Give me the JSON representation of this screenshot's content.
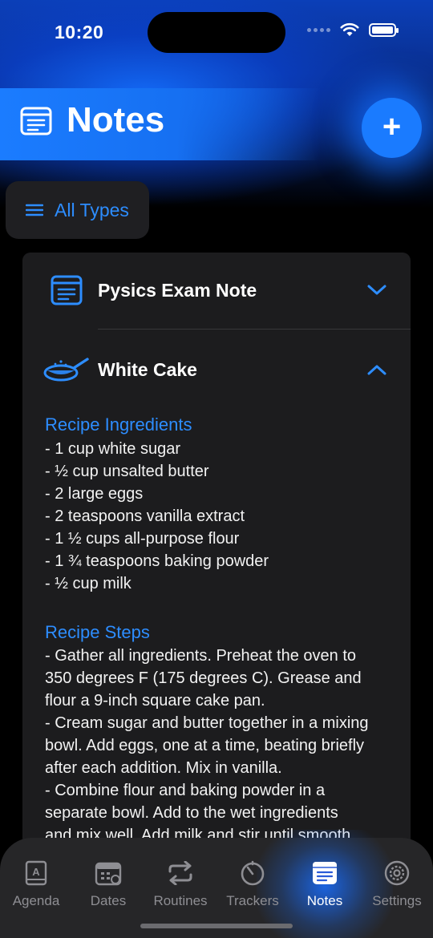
{
  "status_bar": {
    "time": "10:20"
  },
  "header": {
    "title": "Notes",
    "add_button": "+"
  },
  "filter": {
    "label": "All Types"
  },
  "notes": [
    {
      "title": "Pysics Exam Note",
      "icon": "note-icon",
      "expanded": false
    },
    {
      "title": "White Cake",
      "icon": "pan-icon",
      "expanded": true
    }
  ],
  "recipe": {
    "ingredients_title": "Recipe Ingredients",
    "ingredients": [
      "- 1 cup white sugar",
      "- ½ cup unsalted butter",
      "- 2 large eggs",
      "- 2 teaspoons vanilla extract",
      "- 1 ½ cups all-purpose flour",
      "- 1 ¾ teaspoons baking powder",
      "- ½ cup milk"
    ],
    "steps_title": "Recipe Steps",
    "steps_lines": [
      "- Gather all ingredients. Preheat the oven to",
      "350 degrees F (175 degrees C). Grease and",
      "flour a 9-inch square cake pan.",
      "- Cream sugar and butter together in a mixing",
      "bowl. Add eggs, one at a time, beating briefly",
      "after each addition. Mix in vanilla.",
      "- Combine flour and baking powder in a",
      "separate bowl. Add to the wet ingredients",
      "and mix well. Add milk and stir until smooth."
    ]
  },
  "tabs": [
    {
      "label": "Agenda",
      "icon": "agenda-icon",
      "active": false
    },
    {
      "label": "Dates",
      "icon": "calendar-icon",
      "active": false
    },
    {
      "label": "Routines",
      "icon": "repeat-icon",
      "active": false
    },
    {
      "label": "Trackers",
      "icon": "timer-icon",
      "active": false
    },
    {
      "label": "Notes",
      "icon": "notes-icon",
      "active": true
    },
    {
      "label": "Settings",
      "icon": "gear-icon",
      "active": false
    }
  ],
  "colors": {
    "accent": "#2d8dff",
    "card": "#1c1c1e",
    "tabbar": "#262628"
  }
}
